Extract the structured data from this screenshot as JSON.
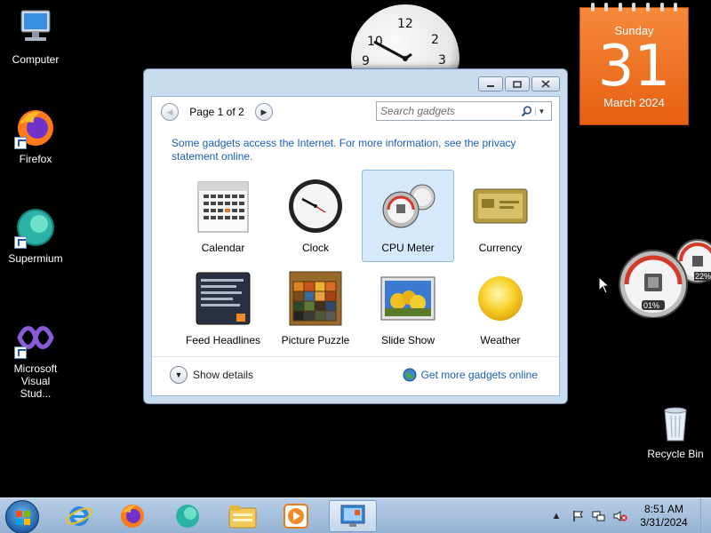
{
  "desktop_icons": [
    {
      "label": "Computer",
      "icon": "computer-icon"
    },
    {
      "label": "Firefox",
      "icon": "firefox-icon"
    },
    {
      "label": "Supermium",
      "icon": "supermium-icon"
    },
    {
      "label": "Microsoft Visual Stud...",
      "icon": "visual-studio-icon"
    },
    {
      "label": "Recycle Bin",
      "icon": "recycle-bin-icon"
    }
  ],
  "calendar_gadget": {
    "weekday": "Sunday",
    "day": "31",
    "month_year": "March 2024"
  },
  "clock_gadget": {
    "numbers": [
      "12",
      "2",
      "3",
      "10",
      "9"
    ]
  },
  "cpu_meter": {
    "cpu": "01%",
    "ram": "22%"
  },
  "gadget_window": {
    "page_label": "Page 1 of 2",
    "search_placeholder": "Search gadgets",
    "notice": "Some gadgets access the Internet.  For more information, see the privacy statement online.",
    "gadgets": [
      {
        "name": "Calendar",
        "icon": "calendar-icon",
        "selected": false
      },
      {
        "name": "Clock",
        "icon": "clock-icon",
        "selected": false
      },
      {
        "name": "CPU Meter",
        "icon": "cpu-meter-icon",
        "selected": true
      },
      {
        "name": "Currency",
        "icon": "currency-icon",
        "selected": false
      },
      {
        "name": "Feed Headlines",
        "icon": "feed-headlines-icon",
        "selected": false
      },
      {
        "name": "Picture Puzzle",
        "icon": "picture-puzzle-icon",
        "selected": false
      },
      {
        "name": "Slide Show",
        "icon": "slide-show-icon",
        "selected": false
      },
      {
        "name": "Weather",
        "icon": "weather-icon",
        "selected": false
      }
    ],
    "show_details": "Show details",
    "more_link": "Get more gadgets online"
  },
  "taskbar": {
    "pinned": [
      "internet-explorer-icon",
      "firefox-icon",
      "supermium-icon",
      "file-explorer-icon",
      "media-player-icon",
      "gadgets-icon"
    ],
    "time": "8:51 AM",
    "date": "3/31/2024"
  },
  "colors": {
    "link": "#1a5fb4",
    "calendar": "#e85f12",
    "taskbar": "#a5c0dc"
  }
}
